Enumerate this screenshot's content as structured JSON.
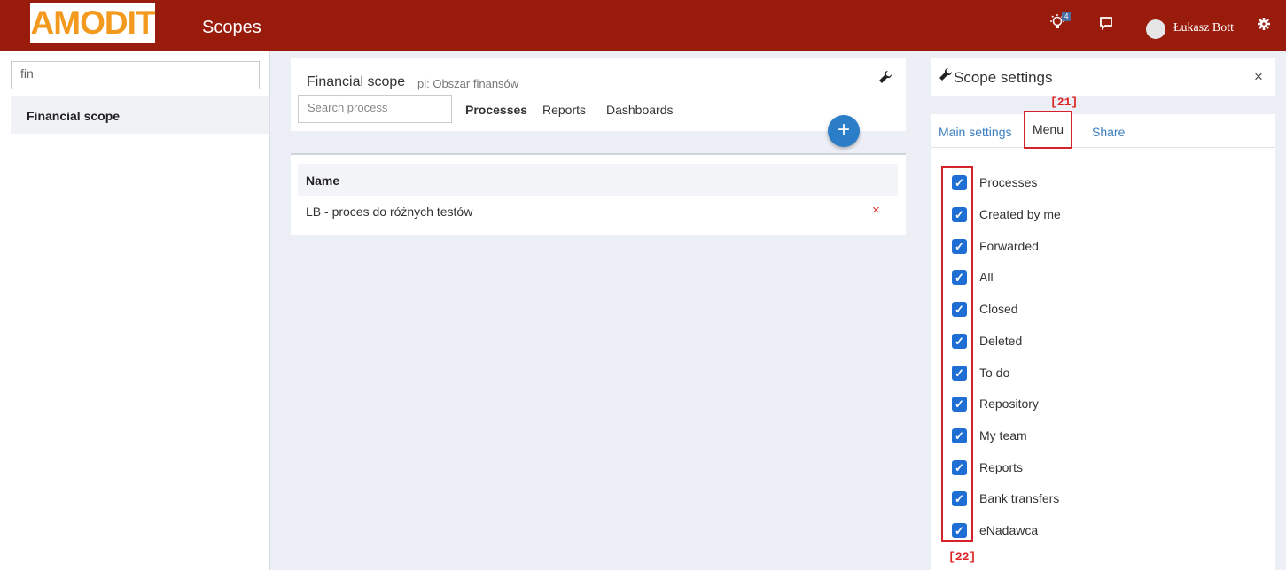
{
  "topbar": {
    "logo": "AMODIT",
    "title": "Scopes",
    "notification_count": "4",
    "username": "Łukasz Bott"
  },
  "left": {
    "search_value": "fin",
    "scope_item": "Financial scope"
  },
  "center": {
    "scope_title": "Financial scope",
    "scope_subtitle": "pl: Obszar finansów",
    "search_placeholder": "Search process",
    "tabs": [
      "Processes",
      "Reports",
      "Dashboards"
    ],
    "add_label": "+",
    "table_header": "Name",
    "rows": [
      "LB - proces do różnych testów"
    ],
    "delete_icon": "×"
  },
  "right": {
    "title": "Scope settings",
    "close_icon": "×",
    "tabs": [
      "Main settings",
      "Menu",
      "Share"
    ],
    "label_tab": "[21]",
    "label_list": "[22]",
    "menu_items": [
      "Processes",
      "Created by me",
      "Forwarded",
      "All",
      "Closed",
      "Deleted",
      "To do",
      "Repository",
      "My team",
      "Reports",
      "Bank transfers",
      "eNadawca"
    ],
    "check_mark": "✓"
  },
  "colors": {
    "topbar": "#991b0c",
    "accent_blue": "#2a7dc6",
    "checkbox": "#1f6ed4",
    "highlight": "#d5232d"
  }
}
